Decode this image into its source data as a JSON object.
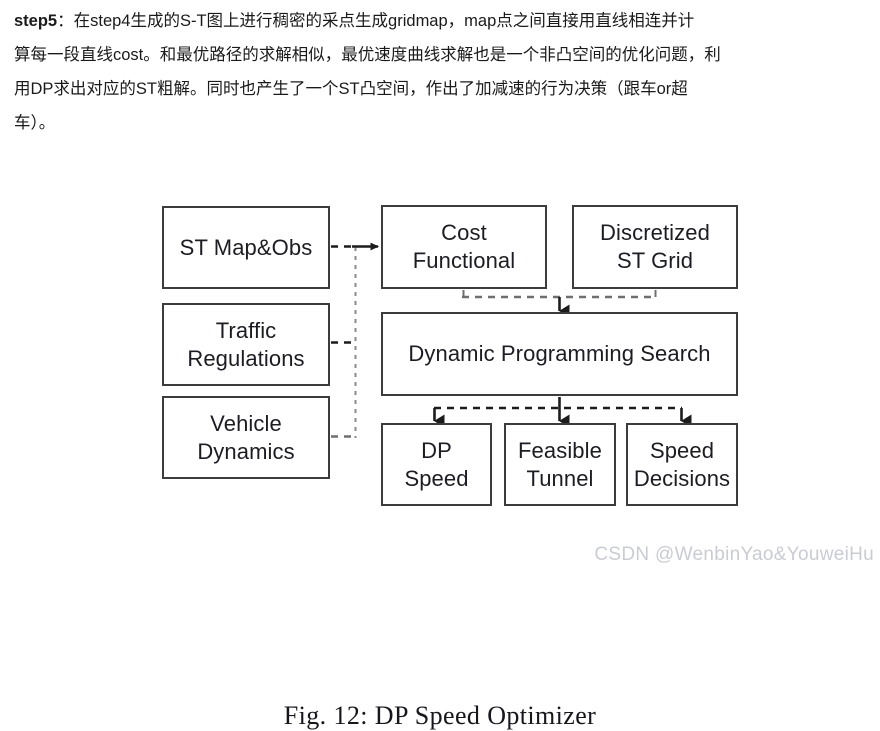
{
  "prose": {
    "lines": [
      {
        "bold": "step5",
        "rest": "：在step4生成的S-T图上进行稠密的采点生成gridmap，map点之间直接用直线相连并计"
      },
      {
        "bold": "",
        "rest": "算每一段直线cost。和最优路径的求解相似，最优速度曲线求解也是一个非凸空间的优化问题，利"
      },
      {
        "bold": "",
        "rest": "用DP求出对应的ST粗解。同时也产生了一个ST凸空间，作出了加减速的行为决策（跟车or超"
      },
      {
        "bold": "",
        "rest": "车）。"
      }
    ]
  },
  "figure": {
    "caption": "Fig. 12: DP Speed Optimizer",
    "nodes": {
      "st_map_obs": "ST Map&Obs",
      "traffic_regulations": "Traffic\nRegulations",
      "vehicle_dynamics": "Vehicle\nDynamics",
      "cost_functional": "Cost\nFunctional",
      "discretized_st_grid": "Discretized\nST Grid",
      "dp_search": "Dynamic Programming Search",
      "dp_speed": "DP\nSpeed",
      "feasible_tunnel": "Feasible\nTunnel",
      "speed_decisions": "Speed\nDecisions"
    },
    "colors": {
      "box_border": "#3c3c3c",
      "box_fill": "#ffffff",
      "text": "#1c1c23",
      "connector": "#3c3c3c",
      "connector_light": "#808080"
    },
    "edges": [
      {
        "from": "st_map_obs",
        "to": "cost_functional",
        "style": "dashed-then-solid-arrow"
      },
      {
        "from": "traffic_regulations",
        "to": "cost_functional",
        "style": "dashed-bus"
      },
      {
        "from": "vehicle_dynamics",
        "to": "cost_functional",
        "style": "dashed-bus"
      },
      {
        "from": "cost_functional",
        "to": "dp_search",
        "style": "dashed-arrow"
      },
      {
        "from": "discretized_st_grid",
        "to": "dp_search",
        "style": "dashed-arrow"
      },
      {
        "from": "dp_search",
        "to": "dp_speed",
        "style": "dashed-arrow"
      },
      {
        "from": "dp_search",
        "to": "feasible_tunnel",
        "style": "dashed-arrow"
      },
      {
        "from": "dp_search",
        "to": "speed_decisions",
        "style": "dashed-arrow"
      }
    ]
  },
  "watermark": {
    "text": "CSDN @WenbinYao&YouweiHu"
  }
}
